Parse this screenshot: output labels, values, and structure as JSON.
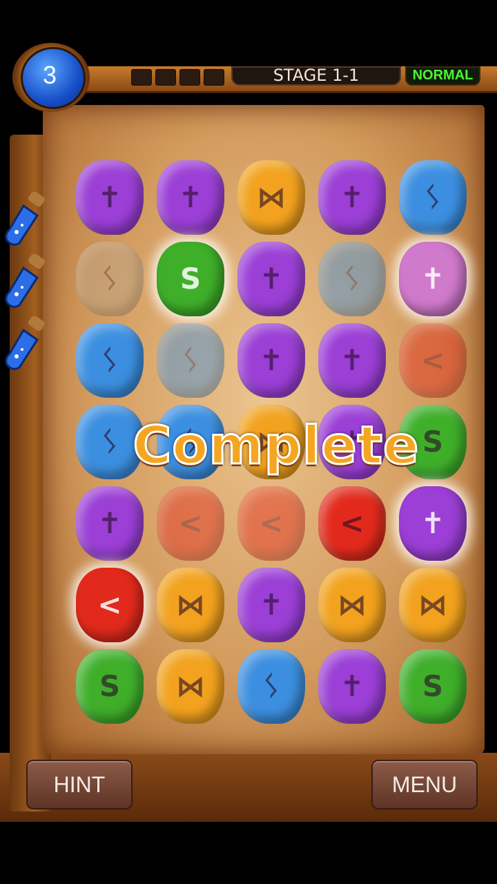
{
  "hud": {
    "orb_count": "3",
    "stage_label": "STAGE 1-1",
    "difficulty": "NORMAL"
  },
  "potions": [
    {
      "icon": "blue-potion-icon"
    },
    {
      "icon": "blue-potion-icon"
    },
    {
      "icon": "blue-potion-icon"
    }
  ],
  "board": {
    "rows": 7,
    "cols": 5,
    "gems": [
      [
        "purple",
        "purple",
        "yellow",
        "purple",
        "blue"
      ],
      [
        "gray-faded",
        "green-glow",
        "purple",
        "blue-faded",
        "pink-glow"
      ],
      [
        "blue",
        "blue-faded",
        "purple",
        "purple",
        "red-faded"
      ],
      [
        "blue",
        "blue",
        "yellow",
        "purple",
        "green"
      ],
      [
        "purple",
        "red-faded",
        "red-faded",
        "red",
        "purple-glow"
      ],
      [
        "red-glow",
        "yellow",
        "purple",
        "yellow",
        "yellow"
      ],
      [
        "green",
        "yellow",
        "blue",
        "purple",
        "green"
      ]
    ]
  },
  "overlay": {
    "message": "Complete"
  },
  "buttons": {
    "hint": "HINT",
    "menu": "MENU"
  },
  "colors": {
    "purple": "#9b3fd6",
    "blue": "#3c8fe0",
    "yellow": "#f2a21e",
    "green": "#3faf2a",
    "red": "#e22a1c",
    "pink": "#d07acb",
    "gray": "#b9a68e"
  }
}
